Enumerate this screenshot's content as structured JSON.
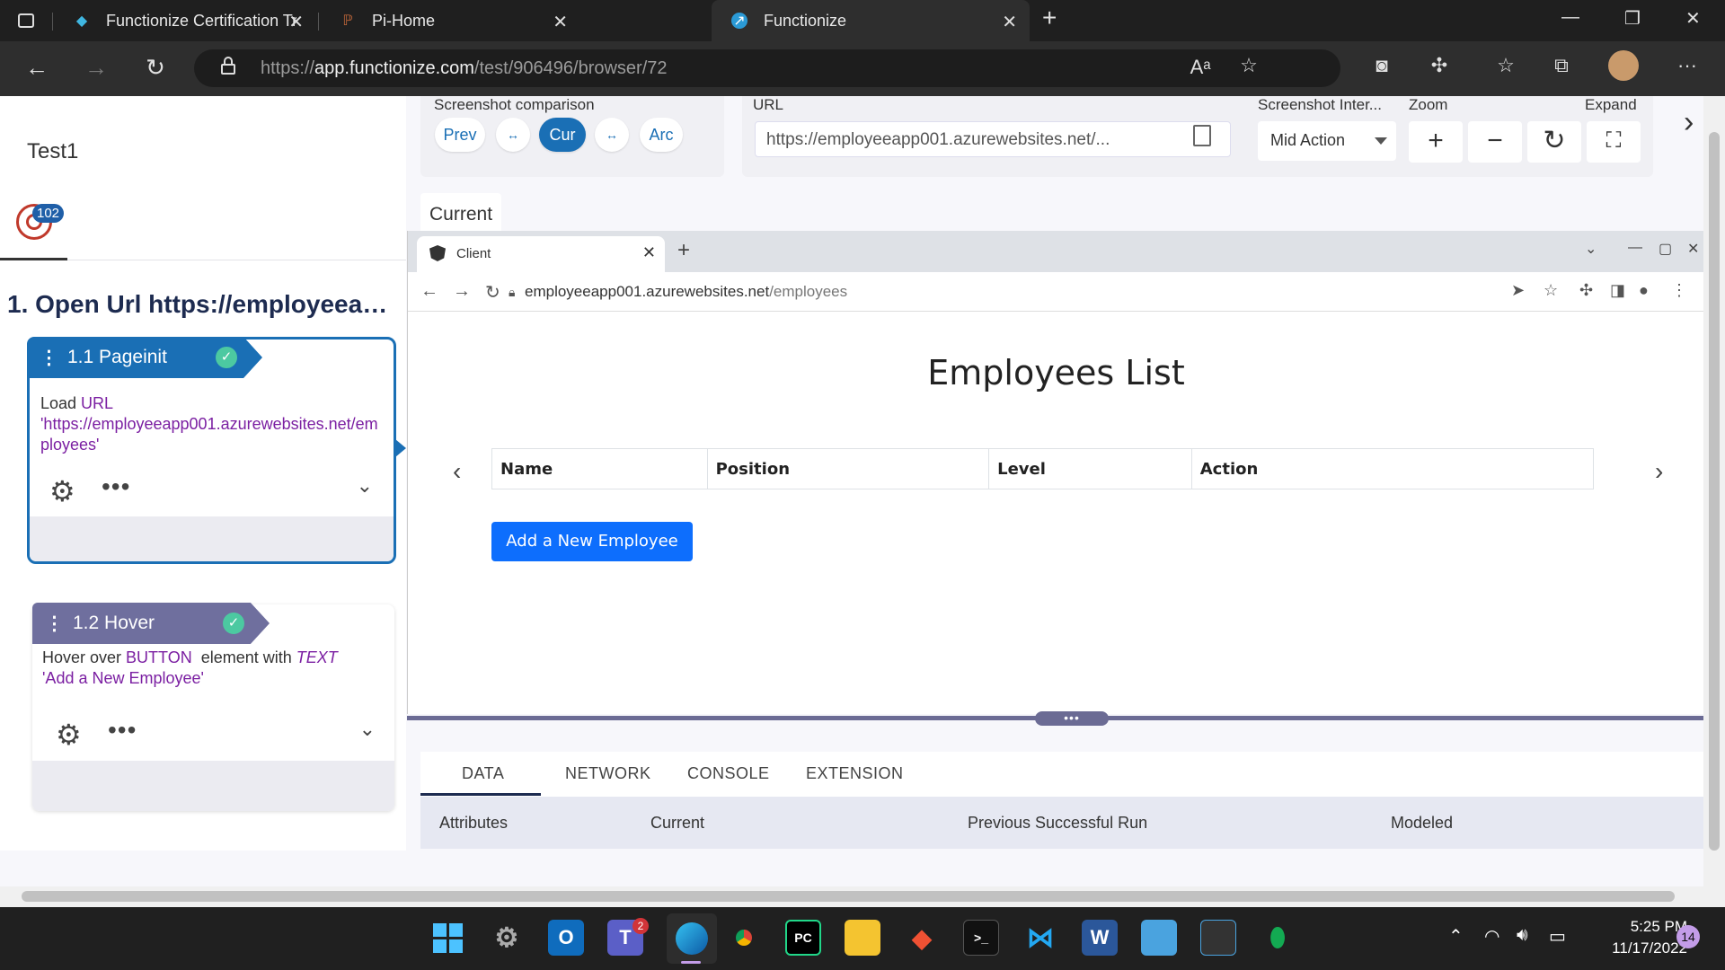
{
  "browser": {
    "tabs": [
      {
        "title": "Functionize Certification Training"
      },
      {
        "title": "Pi-Home"
      },
      {
        "title": "Functionize"
      }
    ],
    "url_base": "https://",
    "url_host": "app.functionize.com",
    "url_path": "/test/906496/browser/72"
  },
  "app": {
    "test_name": "Test1",
    "run_count": "102",
    "step_group_title": "1. Open Url https://employeeap...",
    "steps": [
      {
        "title": "1.1 Pageinit",
        "desc_prefix": "Load ",
        "desc_kw": "URL",
        "desc_value": "'https://employeeapp001.azurewebsites.net/employees'"
      },
      {
        "title": "1.2 Hover",
        "desc_prefix": "Hover over ",
        "desc_kw": "BUTTON",
        "desc_mid": "  element with ",
        "desc_kw2": "TEXT",
        "desc_value": "'Add a New Employee'"
      }
    ],
    "toolbar": {
      "screenshot_comparison_label": "Screenshot comparison",
      "buttons": [
        "Prev",
        "↔",
        "Cur",
        "↔",
        "Arc"
      ],
      "url_label": "URL",
      "url_value": "https://employeeapp001.azurewebsites.net/...",
      "interval_label": "Screenshot Inter...",
      "interval_value": "Mid Action",
      "zoom_label": "Zoom",
      "expand_label": "Expand"
    },
    "current_tab": "Current"
  },
  "screenshot": {
    "tab_title": "Client",
    "url_host": "employeeapp001.azurewebsites.net",
    "url_path": "/employees",
    "heading": "Employees List",
    "columns": [
      "Name",
      "Position",
      "Level",
      "Action"
    ],
    "add_button": "Add a New Employee"
  },
  "bottom_panel": {
    "tabs": [
      "DATA",
      "NETWORK",
      "CONSOLE",
      "EXTENSION"
    ],
    "columns": [
      "Attributes",
      "Current",
      "Previous Successful Run",
      "Modeled"
    ]
  },
  "taskbar": {
    "time": "5:25 PM",
    "date": "11/17/2022",
    "notifications": "14",
    "teams_badge": "2"
  },
  "colors": {
    "primary": "#1a6fb5",
    "step2_header": "#6f6f9e",
    "success": "#4cc9a1",
    "bootstrap_primary": "#0d6efd"
  }
}
